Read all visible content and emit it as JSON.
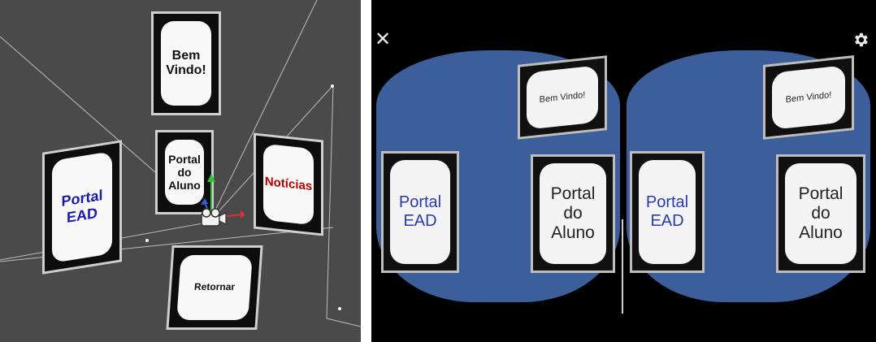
{
  "editor_scene": {
    "panels": {
      "welcome": "Bem Vindo!",
      "student_portal": "Portal do Aluno",
      "news": "Notícias",
      "ead_portal": "Portal EAD",
      "back": "Retornar"
    },
    "colors": {
      "background": "#4a4a4a",
      "news_text": "#b00000",
      "ead_text": "#1a1aa8",
      "gizmo_y": "#35c135",
      "gizmo_x": "#e03030",
      "gizmo_z": "#3060e0"
    }
  },
  "vr_view": {
    "close_icon": "close-icon",
    "settings_icon": "gear-icon",
    "left_eye": {
      "welcome": "Bem Vindo!",
      "student_portal": "Portal do Aluno",
      "ead_portal": "Portal EAD"
    },
    "right_eye": {
      "welcome": "Bem Vindo!",
      "student_portal": "Portal do Aluno",
      "ead_portal": "Portal EAD"
    },
    "colors": {
      "sky": "#3c5f9c",
      "ead_text": "#2a3aa8"
    }
  }
}
